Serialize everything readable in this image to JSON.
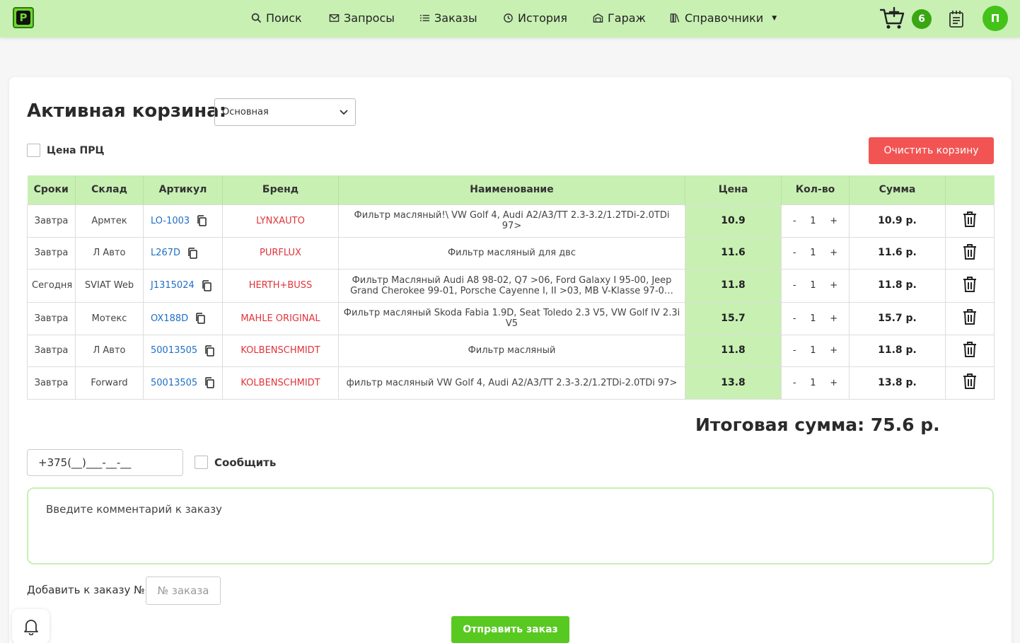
{
  "nav": {
    "items": [
      {
        "label": "Поиск",
        "icon": "search-icon"
      },
      {
        "label": "Запросы",
        "icon": "mail-icon"
      },
      {
        "label": "Заказы",
        "icon": "list-icon"
      },
      {
        "label": "История",
        "icon": "history-icon"
      },
      {
        "label": "Гараж",
        "icon": "garage-icon"
      },
      {
        "label": "Справочники",
        "icon": "books-icon"
      }
    ],
    "logo_letter": "P",
    "cart_count": "6",
    "avatar_letter": "П"
  },
  "cart": {
    "title": "Активная корзина:",
    "selected_basket": "Основная",
    "prc_label": "Цена ПРЦ",
    "clear_label": "Очистить корзину",
    "columns": [
      "Сроки",
      "Склад",
      "Артикул",
      "Бренд",
      "Наименование",
      "Цена",
      "Кол-во",
      "Сумма",
      ""
    ],
    "rows": [
      {
        "term": "Завтра",
        "warehouse": "Армтек",
        "article": "LO-1003",
        "brand": "LYNXAUTO",
        "name": "Фильтр масляный!\\ VW Golf 4, Audi A2/A3/TT 2.3-3.2/1.2TDi-2.0TDi 97>",
        "price": "10.9",
        "qty": "1",
        "sum": "10.9 р."
      },
      {
        "term": "Завтра",
        "warehouse": "Л Авто",
        "article": "L267D",
        "brand": "PURFLUX",
        "name": "Фильтр масляный для двс",
        "price": "11.6",
        "qty": "1",
        "sum": "11.6 р."
      },
      {
        "term": "Сегодня",
        "warehouse": "SVIAT Web",
        "article": "J1315024",
        "brand": "HERTH+BUSS",
        "name": "Фильтр Масляный Audi A8 98-02, Q7 >06, Ford Galaxy I 95-00, Jeep Grand Cherokee 99-01, Porsche Cayenne I, II >03, MB V-Klasse 97-0…",
        "price": "11.8",
        "qty": "1",
        "sum": "11.8 р."
      },
      {
        "term": "Завтра",
        "warehouse": "Мотекс",
        "article": "OX188D",
        "brand": "MAHLE ORIGINAL",
        "name": "Фильтр масляный Skoda Fabia 1.9D, Seat Toledo 2.3 V5, VW Golf IV 2.3i V5",
        "price": "15.7",
        "qty": "1",
        "sum": "15.7 р."
      },
      {
        "term": "Завтра",
        "warehouse": "Л Авто",
        "article": "50013505",
        "brand": "KOLBENSCHMIDT",
        "name": "Фильтр масляный",
        "price": "11.8",
        "qty": "1",
        "sum": "11.8 р."
      },
      {
        "term": "Завтра",
        "warehouse": "Forward",
        "article": "50013505",
        "brand": "KOLBENSCHMIDT",
        "name": "фильтр масляный VW Golf 4, Audi A2/A3/TT 2.3-3.2/1.2TDi-2.0TDi 97>",
        "price": "13.8",
        "qty": "1",
        "sum": "13.8 р."
      }
    ],
    "qty_minus": "-",
    "qty_plus": "+",
    "total": "Итоговая сумма: 75.6 р."
  },
  "order": {
    "phone_value": "+375(__)___-__-__",
    "notify_label": "Сообщить",
    "comment_placeholder": "Введите комментарий к заказу",
    "add_to_order_label": "Добавить к заказу №",
    "order_number_placeholder": "№ заказа",
    "send_label": "Отправить заказ"
  },
  "colors": {
    "header_bg": "#c8f0b3",
    "accent_green": "#58c920",
    "danger": "#f25454",
    "link_blue": "#1f6fc4",
    "brand_red": "#e0343a"
  }
}
